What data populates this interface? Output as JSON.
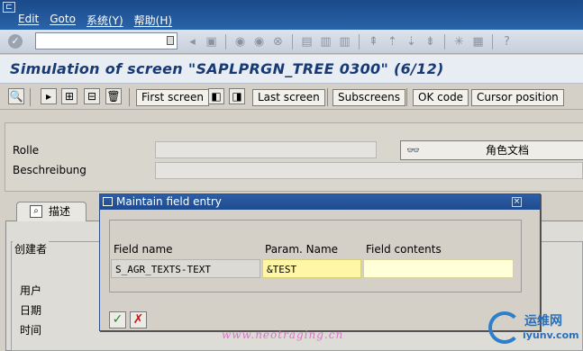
{
  "menu": {
    "items": [
      "Edit",
      "Goto",
      "系统(Y)",
      "帮助(H)"
    ]
  },
  "std_toolbar": {
    "command_value": "",
    "icons": [
      "back-icon",
      "exit-icon",
      "cancel-icon",
      "print-icon",
      "find-icon",
      "find-next-icon",
      "first-page-icon",
      "previous-page-icon",
      "next-page-icon",
      "last-page-icon",
      "create-session-icon",
      "shortcut-icon",
      "help-icon"
    ]
  },
  "title": "Simulation of screen \"SAPLPRGN_TREE 0300\" (6/12)",
  "app_toolbar": {
    "first_screen": "First screen",
    "last_screen": "Last screen",
    "subscreens": "Subscreens",
    "ok_code": "OK code",
    "cursor_position": "Cursor position"
  },
  "header": {
    "rolle_label": "Rolle",
    "beschreibung_label": "Beschreibung",
    "doc_button": "角色文档"
  },
  "tabs": {
    "active": "描述"
  },
  "creator_group": {
    "title": "创建者",
    "fields": [
      "用户",
      "日期",
      "时间"
    ]
  },
  "dialog": {
    "title": "Maintain field entry",
    "col_field_name": "Field name",
    "col_param_name": "Param. Name",
    "col_field_contents": "Field contents",
    "field_name": "S_AGR_TEXTS-TEXT",
    "param_name": "&TEST",
    "field_contents": ""
  },
  "watermarks": {
    "left": "www.neotraging.cn",
    "right_cn": "运维网",
    "right_en": "iyunv.com"
  },
  "colors": {
    "menubar": "#1f4b8e",
    "title_text": "#173a74",
    "param_field": "#fff7a6",
    "ok_green": "#1e8a1e",
    "cancel_red": "#c01818"
  }
}
